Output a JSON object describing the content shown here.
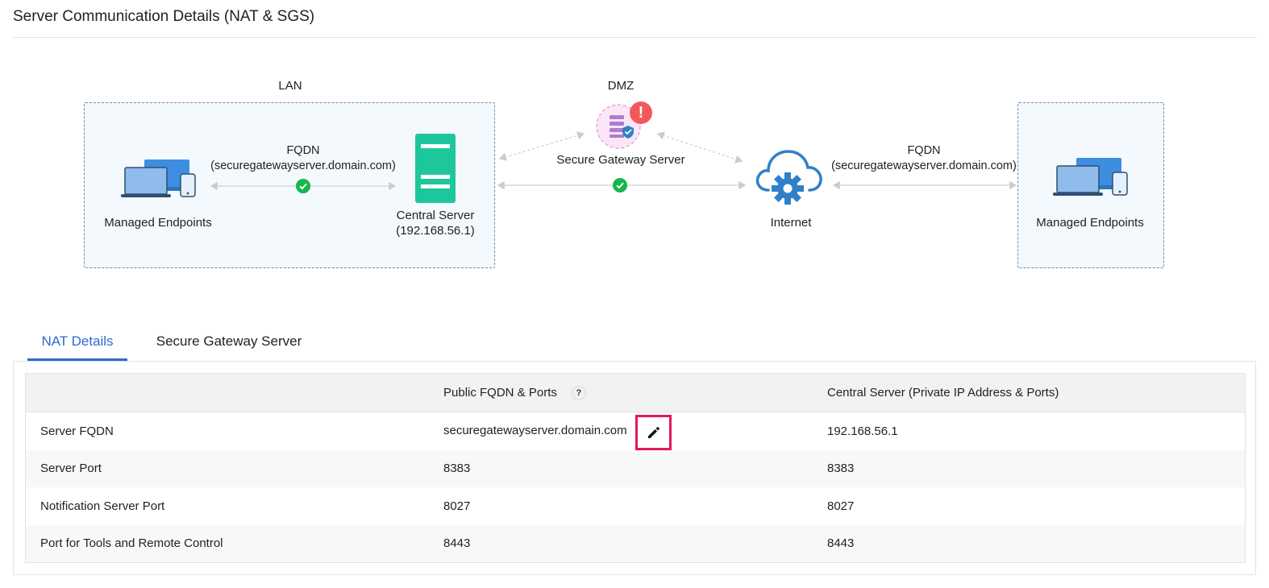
{
  "page": {
    "title": "Server Communication Details (NAT & SGS)"
  },
  "diagram": {
    "lan_label": "LAN",
    "dmz_label": "DMZ",
    "lan_endpoints_label": "Managed Endpoints",
    "lan_fqdn_title": "FQDN",
    "lan_fqdn_value": "(securegatewayserver.domain.com)",
    "central_server_label": "Central Server",
    "central_server_ip": "(192.168.56.1)",
    "sgs_label": "Secure Gateway Server",
    "internet_label": "Internet",
    "remote_fqdn_title": "FQDN",
    "remote_fqdn_value": "(securegatewayserver.domain.com)",
    "remote_endpoints_label": "Managed Endpoints",
    "sgs_alert_symbol": "!",
    "status_ok_icon": "check-circle-icon",
    "colors": {
      "server_green": "#1ec79b",
      "alert_red": "#f4585c",
      "cloud_blue": "#2f80c8",
      "device_blue": "#3d8ee0",
      "zone_border": "#6d8fb4"
    }
  },
  "tabs": [
    {
      "label": "NAT Details",
      "active": true
    },
    {
      "label": "Secure Gateway Server",
      "active": false
    }
  ],
  "table": {
    "headers": [
      "",
      "Public FQDN & Ports",
      "Central Server (Private IP Address & Ports)"
    ],
    "help_symbol": "?",
    "rows": [
      {
        "label": "Server FQDN",
        "public": "securegatewayserver.domain.com",
        "private": "192.168.56.1"
      },
      {
        "label": "Server Port",
        "public": "8383",
        "private": "8383"
      },
      {
        "label": "Notification Server Port",
        "public": "8027",
        "private": "8027"
      },
      {
        "label": "Port for Tools and Remote Control",
        "public": "8443",
        "private": "8443"
      }
    ]
  }
}
